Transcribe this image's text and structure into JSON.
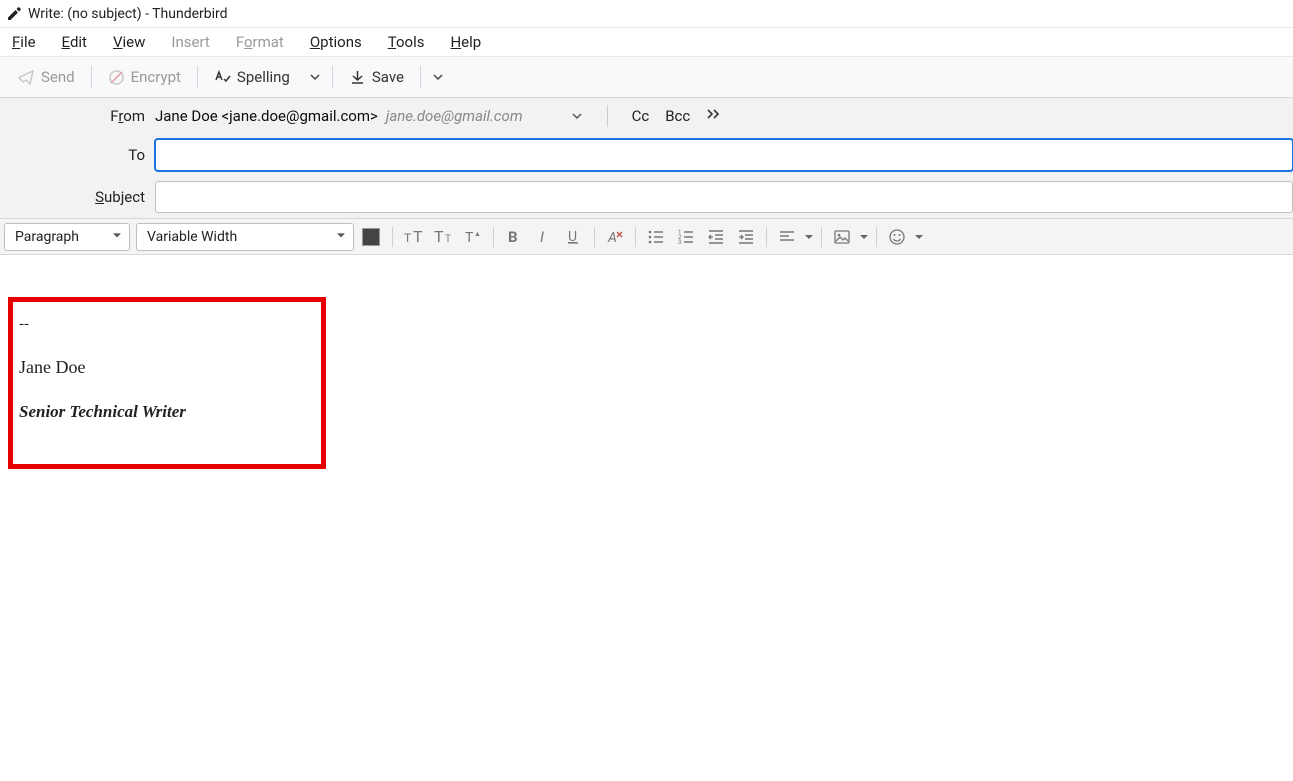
{
  "window": {
    "title": "Write: (no subject) - Thunderbird"
  },
  "menu": {
    "file": "File",
    "edit": "Edit",
    "view": "View",
    "insert": "Insert",
    "format": "Format",
    "options": "Options",
    "tools": "Tools",
    "help": "Help"
  },
  "toolbar": {
    "send": "Send",
    "encrypt": "Encrypt",
    "spelling": "Spelling",
    "save": "Save"
  },
  "header": {
    "from_label": "From",
    "from_identity": "Jane Doe <jane.doe@gmail.com>",
    "from_account": "jane.doe@gmail.com",
    "cc_label": "Cc",
    "bcc_label": "Bcc",
    "to_label": "To",
    "to_value": "",
    "subject_label": "Subject",
    "subject_value": ""
  },
  "format_bar": {
    "paragraph_select": "Paragraph",
    "font_select": "Variable Width"
  },
  "signature": {
    "separator": "--",
    "name": "Jane Doe",
    "role": "Senior Technical Writer"
  }
}
